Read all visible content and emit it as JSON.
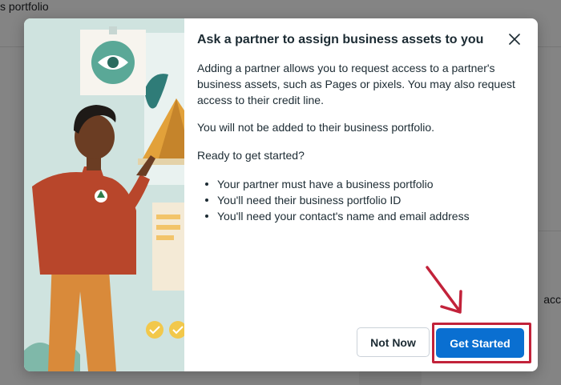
{
  "background": {
    "title_fragment": "s portfolio",
    "edge_fragment": "acc"
  },
  "modal": {
    "title": "Ask a partner to assign business assets to you",
    "paragraphs": [
      "Adding a partner allows you to request access to a partner's business assets, such as Pages or pixels. You may also request access to their credit line.",
      "You will not be added to their business portfolio.",
      "Ready to get started?"
    ],
    "requirements": [
      "Your partner must have a business portfolio",
      "You'll need their business portfolio ID",
      "You'll need your contact's name and email address"
    ],
    "buttons": {
      "secondary_label": "Not Now",
      "primary_label": "Get Started"
    },
    "icons": {
      "close": "close-icon",
      "eye": "eye-icon",
      "tree": "tree-badge-icon",
      "check": "check-icon"
    }
  },
  "colors": {
    "primary": "#0a6fd1",
    "annotation": "#c2223a",
    "illustration_bg": "#cfe3df",
    "eye_circle": "#5aa897"
  }
}
